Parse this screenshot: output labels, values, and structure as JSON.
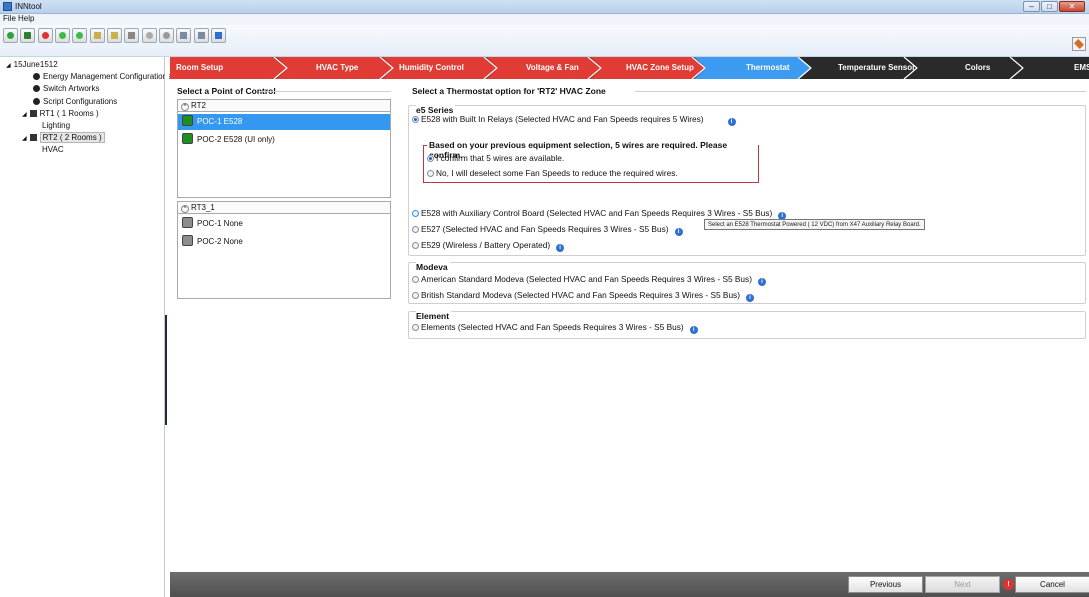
{
  "window": {
    "title": "INNtool"
  },
  "menu": {
    "items": [
      "File",
      "Help"
    ]
  },
  "toolbar": {
    "buttons": [
      "add-icon",
      "open-folder-icon",
      "new-document-icon",
      "add-circle-icon",
      "remove-circle-icon",
      "align-icon",
      "list-icon",
      "document-icon",
      "download-icon",
      "link-icon",
      "edit-icon",
      "edit-alt-icon",
      "save-icon"
    ]
  },
  "tree": {
    "root": "15June1512",
    "items": [
      {
        "label": "Energy Management Configurations"
      },
      {
        "label": "Switch Artworks"
      },
      {
        "label": "Script Configurations"
      },
      {
        "label": "RT1 ( 1 Rooms )"
      },
      {
        "label": "Lighting"
      },
      {
        "label": "RT2 ( 2 Rooms )"
      },
      {
        "label": "HVAC"
      }
    ]
  },
  "steps": [
    {
      "label": "Room Setup"
    },
    {
      "label": "HVAC Type"
    },
    {
      "label": "Humidity Control"
    },
    {
      "label": "Voltage & Fan"
    },
    {
      "label": "HVAC Zone Setup"
    },
    {
      "label": "Thermostat"
    },
    {
      "label": "Temperature Sensor"
    },
    {
      "label": "Colors"
    },
    {
      "label": "EMS"
    }
  ],
  "poc": {
    "title": "Select a Point of Control",
    "groups": [
      {
        "name": "RT2",
        "rows": [
          {
            "label": "POC-1  E528"
          },
          {
            "label": "POC-2  E528 (UI only)"
          }
        ]
      },
      {
        "name": "RT3_1",
        "rows": [
          {
            "label": "POC-1  None"
          },
          {
            "label": "POC-2  None"
          }
        ]
      }
    ]
  },
  "thermostat": {
    "title": "Select a Thermostat option for 'RT2' HVAC Zone",
    "e5": {
      "title": "e5 Series",
      "opt1": "E528 with Built In Relays (Selected HVAC and Fan Speeds requires  5  Wires)",
      "confirm_title": "Based on your previous equipment selection, 5 wires are required. Please confirm.",
      "confirm_yes": "I confirm that 5 wires are available.",
      "confirm_no": "No, I will deselect some Fan Speeds to reduce the required wires.",
      "opt2": "E528 with Auxiliary Control Board (Selected HVAC and Fan Speeds Requires 3 Wires - S5 Bus)",
      "opt3": "E527 (Selected HVAC and Fan Speeds Requires 3 Wires - S5 Bus)",
      "opt4": "E529 (Wireless / Battery Operated)",
      "tooltip": "Select an E528 Thermostat Powered ( 12 VDC) from X47 Auxiliary Relay Board."
    },
    "modeva": {
      "title": "Modeva",
      "opt1": "American Standard Modeva (Selected HVAC and Fan Speeds Requires 3 Wires - S5 Bus)",
      "opt2": "British Standard Modeva (Selected HVAC and Fan Speeds Requires 3 Wires - S5 Bus)"
    },
    "element": {
      "title": "Element",
      "opt1": "Elements (Selected HVAC and Fan Speeds Requires 3 Wires - S5 Bus)"
    }
  },
  "footer": {
    "previous": "Previous",
    "next": "Next",
    "cancel": "Cancel",
    "warning": "!"
  },
  "colors": {
    "step_red": "#e03b34",
    "step_blue": "#3a9bf0",
    "poc_green": "#1f8f1f",
    "poc_gray": "#8d8d8d",
    "selected_row": "#3498f0"
  }
}
